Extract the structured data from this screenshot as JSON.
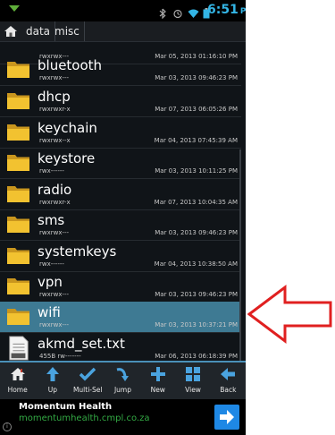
{
  "statusbar": {
    "time": "6:51",
    "ampm": "PM"
  },
  "breadcrumb": [
    "data",
    "misc"
  ],
  "files": [
    {
      "name": "",
      "perm": "rwxrwx---",
      "date": "Mar 05, 2013 01:16:10 PM",
      "type": "folder"
    },
    {
      "name": "bluetooth",
      "perm": "rwxrwx---",
      "date": "Mar 03, 2013 09:46:23 PM",
      "type": "folder"
    },
    {
      "name": "dhcp",
      "perm": "rwxrwxr-x",
      "date": "Mar 07, 2013 06:05:26 PM",
      "type": "folder"
    },
    {
      "name": "keychain",
      "perm": "rwxrwx--x",
      "date": "Mar 04, 2013 07:45:39 AM",
      "type": "folder"
    },
    {
      "name": "keystore",
      "perm": "rwx------",
      "date": "Mar 03, 2013 10:11:25 PM",
      "type": "folder"
    },
    {
      "name": "radio",
      "perm": "rwxrwxr-x",
      "date": "Mar 07, 2013 10:04:35 AM",
      "type": "folder"
    },
    {
      "name": "sms",
      "perm": "rwxrwx---",
      "date": "Mar 03, 2013 09:46:23 PM",
      "type": "folder"
    },
    {
      "name": "systemkeys",
      "perm": "rwx------",
      "date": "Mar 04, 2013 10:38:50 AM",
      "type": "folder"
    },
    {
      "name": "vpn",
      "perm": "rwxrwx---",
      "date": "Mar 03, 2013 09:46:23 PM",
      "type": "folder"
    },
    {
      "name": "wifi",
      "perm": "rwxrwx---",
      "date": "Mar 03, 2013 10:37:21 PM",
      "type": "folder",
      "selected": true
    },
    {
      "name": "akmd_set.txt",
      "perm": "455B rw-------",
      "date": "Mar 06, 2013 06:18:39 PM",
      "type": "file"
    }
  ],
  "toolbar": {
    "home": "Home",
    "up": "Up",
    "multisel": "Multi-Sel",
    "jump": "Jump",
    "new": "New",
    "view": "View",
    "back": "Back"
  },
  "ad": {
    "title": "Momentum Health",
    "url": "momentumhealth.cmpl.co.za",
    "info": "i"
  },
  "colors": {
    "selection": "#3e7a93",
    "folder": "#f2c230",
    "accent": "#33b5e5",
    "arrow": "#e02020"
  }
}
